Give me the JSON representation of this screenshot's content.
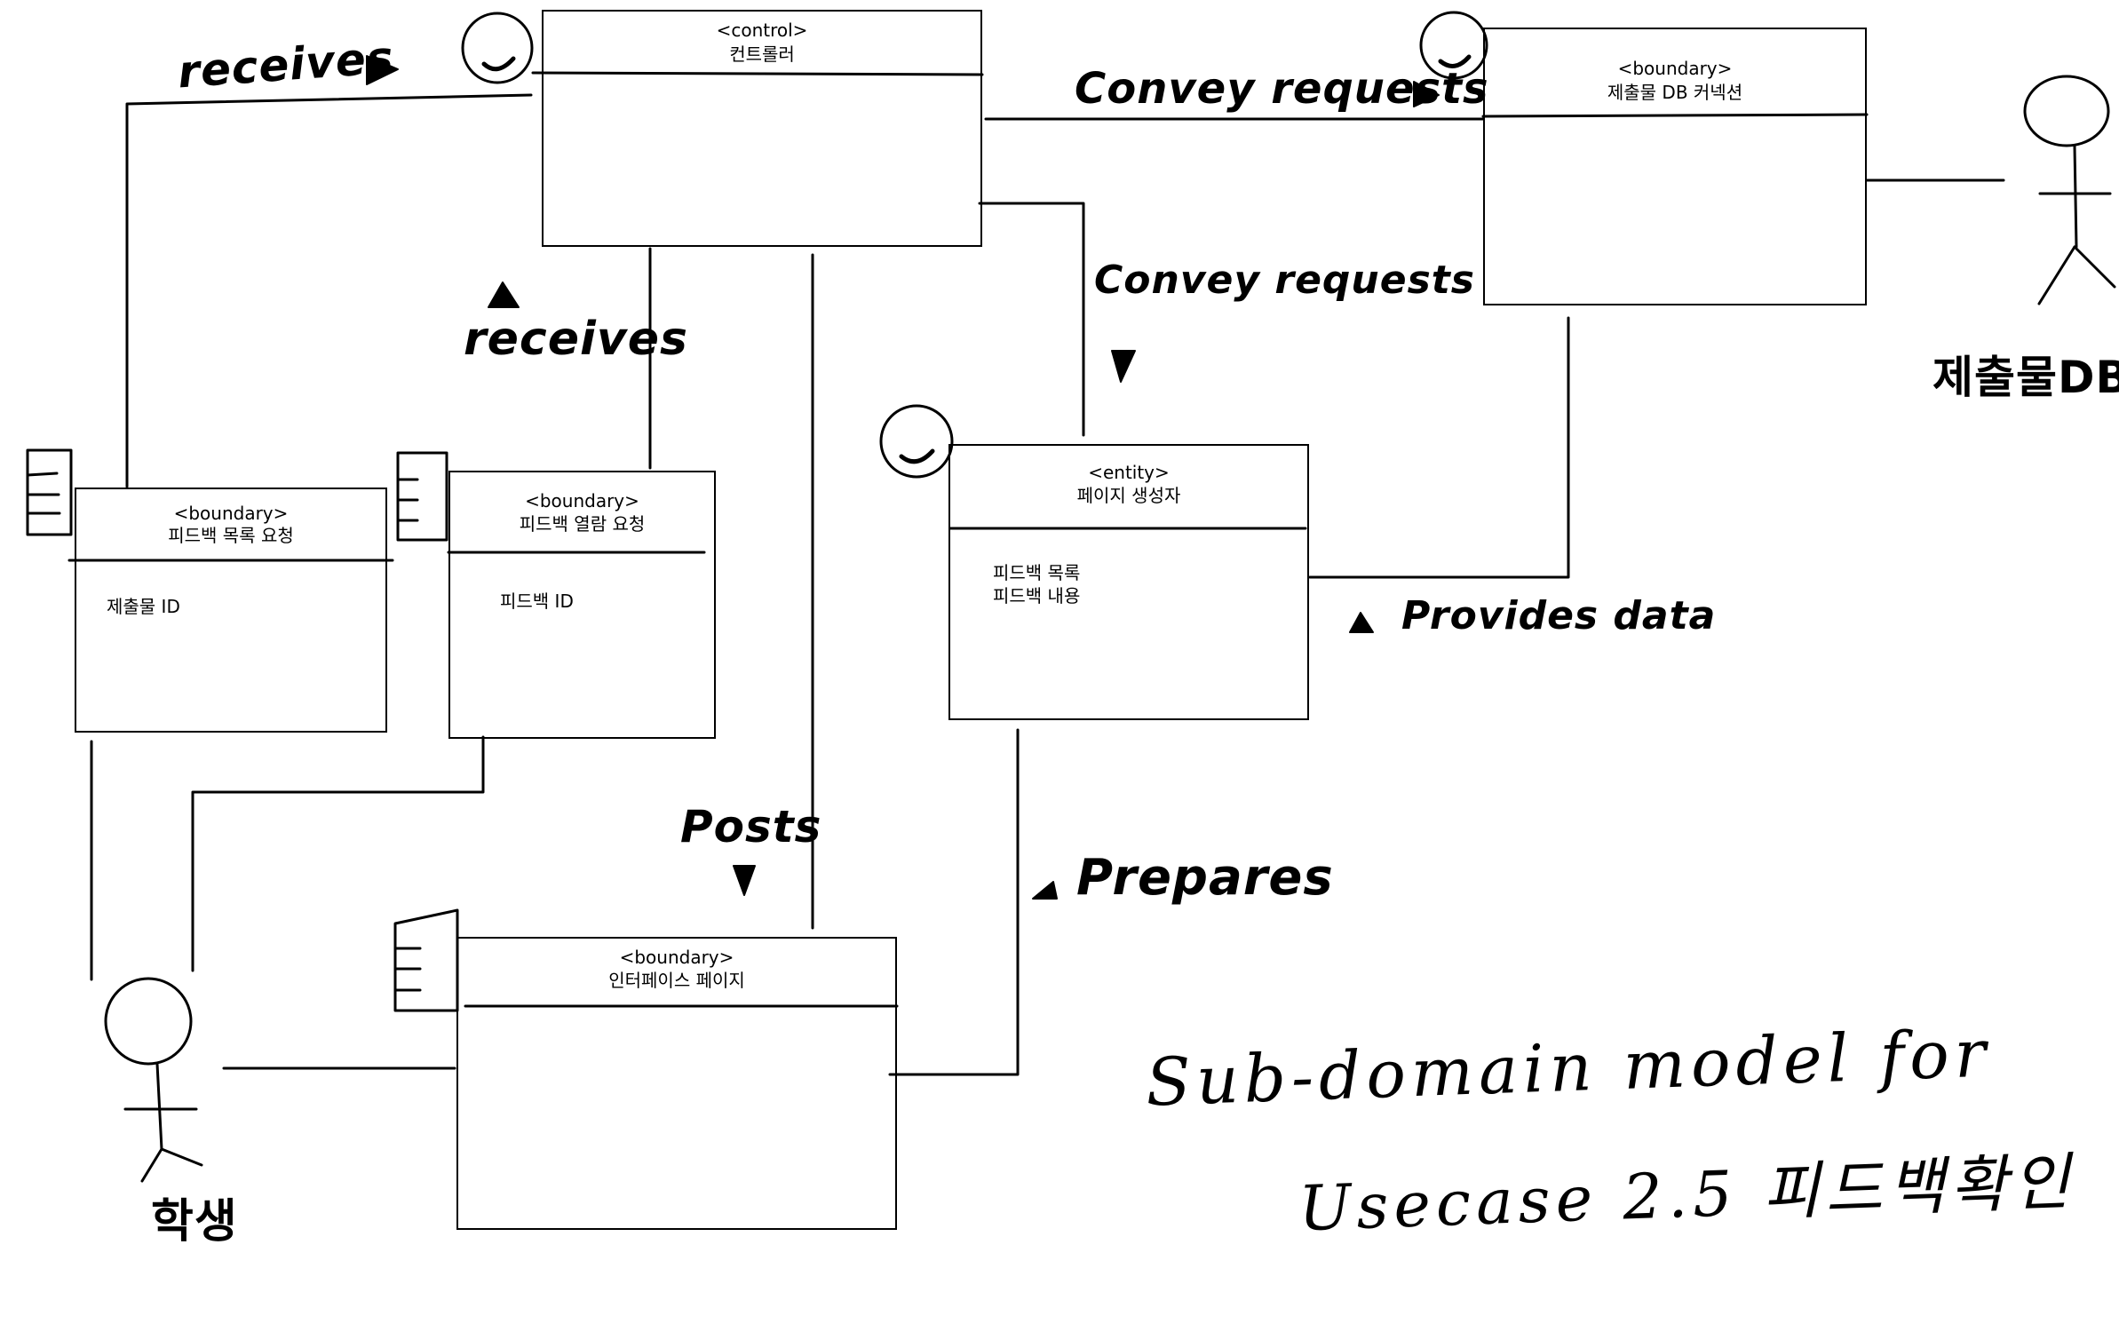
{
  "boxes": {
    "controller": {
      "stereotype": "<control>",
      "name": "컨트롤러"
    },
    "db_connection": {
      "stereotype": "<boundary>",
      "name": "제출물 DB 커넥션"
    },
    "feedback_list_request": {
      "stereotype": "<boundary>",
      "name": "피드백 목록 요청",
      "attrs": [
        "제출물 ID"
      ]
    },
    "feedback_view_request": {
      "stereotype": "<boundary>",
      "name": "피드백 열람 요청",
      "attrs": [
        "피드백 ID"
      ]
    },
    "page_generator": {
      "stereotype": "<entity>",
      "name": "페이지 생성자",
      "attrs": [
        "피드백 목록",
        "피드백 내용"
      ]
    },
    "interface_page": {
      "stereotype": "<boundary>",
      "name": "인터페이스 페이지"
    }
  },
  "labels": {
    "receives_top": "receives",
    "receives_mid": "receives",
    "convey_top": "Convey requests",
    "convey_mid": "Convey requests",
    "provides": "Provides data",
    "posts": "Posts",
    "prepares": "Prepares"
  },
  "actors": {
    "db": "제출물DB",
    "student": "학생"
  },
  "caption": {
    "line1": "Sub-domain model for",
    "line2": "Usecase 2.5 피드백확인"
  }
}
